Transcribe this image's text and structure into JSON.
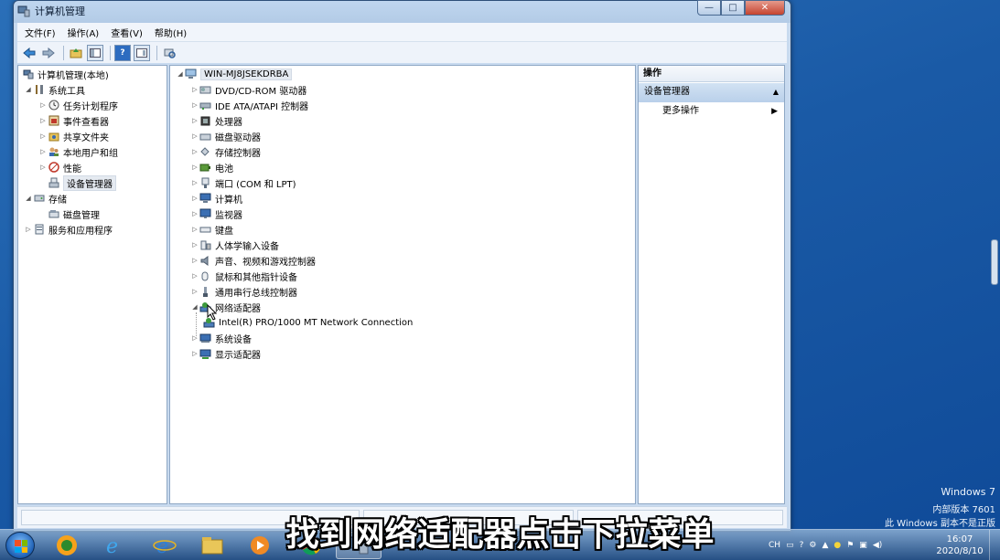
{
  "window": {
    "title": "计算机管理",
    "controls": {
      "minimize": "—",
      "maximize": "□",
      "close": "✕"
    }
  },
  "menu": [
    "文件(F)",
    "操作(A)",
    "查看(V)",
    "帮助(H)"
  ],
  "toolbar": {
    "icons": [
      "back-arrow-icon",
      "forward-arrow-icon",
      "up-folder-icon",
      "show-tree-icon",
      "help-icon",
      "properties-icon",
      "scan-hardware-icon"
    ]
  },
  "left_tree": [
    {
      "label": "计算机管理(本地)",
      "icon": "computer-management-icon",
      "expander": ""
    },
    {
      "label": "系统工具",
      "icon": "tools-icon",
      "expander": "◢"
    },
    {
      "label": "任务计划程序",
      "icon": "clock-icon",
      "expander": "▷"
    },
    {
      "label": "事件查看器",
      "icon": "event-viewer-icon",
      "expander": "▷"
    },
    {
      "label": "共享文件夹",
      "icon": "shared-folder-icon",
      "expander": "▷"
    },
    {
      "label": "本地用户和组",
      "icon": "users-icon",
      "expander": "▷"
    },
    {
      "label": "性能",
      "icon": "performance-icon",
      "expander": "▷"
    },
    {
      "label": "设备管理器",
      "icon": "device-manager-icon",
      "expander": ""
    },
    {
      "label": "存储",
      "icon": "storage-icon",
      "expander": "◢"
    },
    {
      "label": "磁盘管理",
      "icon": "disk-management-icon",
      "expander": ""
    },
    {
      "label": "服务和应用程序",
      "icon": "services-icon",
      "expander": "▷"
    }
  ],
  "device_tree": {
    "root": "WIN-MJ8JSEKDRBA",
    "categories": [
      {
        "label": "DVD/CD-ROM 驱动器",
        "icon": "dvd-icon",
        "expander": "▷"
      },
      {
        "label": "IDE ATA/ATAPI 控制器",
        "icon": "ide-controller-icon",
        "expander": "▷"
      },
      {
        "label": "处理器",
        "icon": "processor-icon",
        "expander": "▷"
      },
      {
        "label": "磁盘驱动器",
        "icon": "disk-drive-icon",
        "expander": "▷"
      },
      {
        "label": "存储控制器",
        "icon": "storage-controller-icon",
        "expander": "▷"
      },
      {
        "label": "电池",
        "icon": "battery-icon",
        "expander": "▷"
      },
      {
        "label": "端口 (COM 和 LPT)",
        "icon": "port-icon",
        "expander": "▷"
      },
      {
        "label": "计算机",
        "icon": "computer-icon",
        "expander": "▷"
      },
      {
        "label": "监视器",
        "icon": "monitor-icon",
        "expander": "▷"
      },
      {
        "label": "键盘",
        "icon": "keyboard-icon",
        "expander": "▷"
      },
      {
        "label": "人体学输入设备",
        "icon": "hid-icon",
        "expander": "▷"
      },
      {
        "label": "声音、视频和游戏控制器",
        "icon": "sound-icon",
        "expander": "▷"
      },
      {
        "label": "鼠标和其他指针设备",
        "icon": "mouse-icon",
        "expander": "▷"
      },
      {
        "label": "通用串行总线控制器",
        "icon": "usb-icon",
        "expander": "▷"
      },
      {
        "label": "网络适配器",
        "icon": "network-adapter-icon",
        "expander": "◢"
      },
      {
        "label": "Intel(R) PRO/1000 MT Network Connection",
        "icon": "network-card-icon",
        "expander": ""
      },
      {
        "label": "系统设备",
        "icon": "system-device-icon",
        "expander": "▷"
      },
      {
        "label": "显示适配器",
        "icon": "display-adapter-icon",
        "expander": "▷"
      }
    ]
  },
  "actions": {
    "header": "操作",
    "section": "设备管理器",
    "more": "更多操作"
  },
  "watermark": [
    "Windows 7",
    "内部版本 7601",
    "此 Windows 副本不是正版"
  ],
  "subtitle": "找到网络适配器点击下拉菜单",
  "taskbar": {
    "tray": {
      "lang": "CH"
    },
    "time": "16:07",
    "date": "2020/8/10"
  },
  "colors": {
    "desktop": "#1a5aa6",
    "selection": "#e5eaf1",
    "accent": "#b9d0ea"
  }
}
